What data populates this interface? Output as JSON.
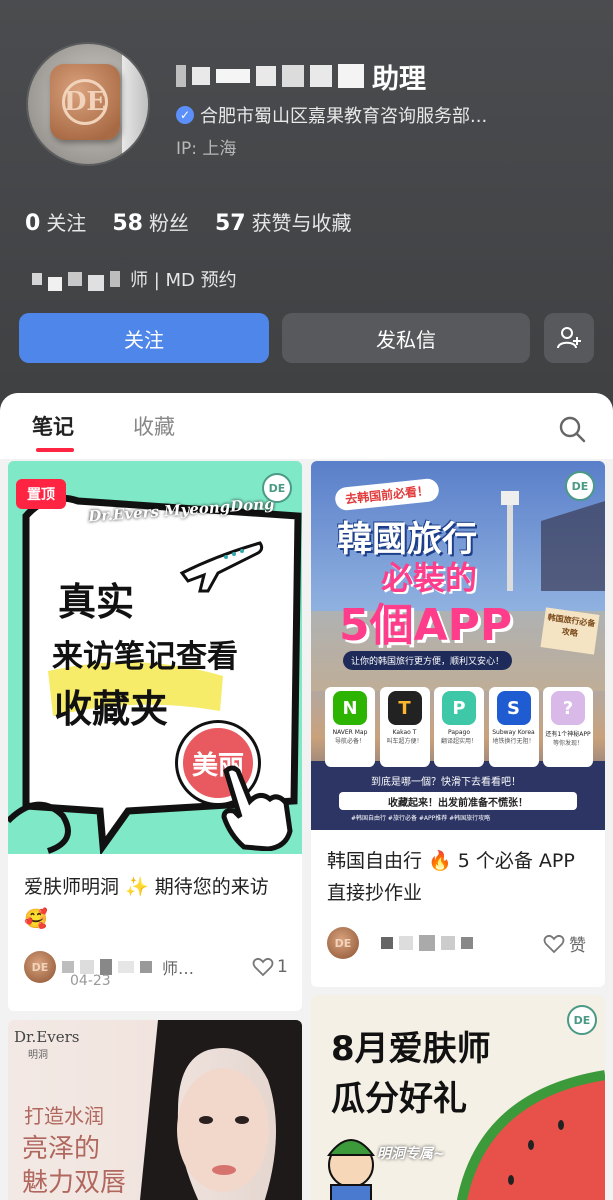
{
  "profile": {
    "name_suffix": "助理",
    "verified_org": "合肥市蜀山区嘉果教育咨询服务部...",
    "ip_label": "IP: 上海",
    "stats": [
      {
        "num": "0",
        "label": "关注"
      },
      {
        "num": "58",
        "label": "粉丝"
      },
      {
        "num": "57",
        "label": "获赞与收藏"
      }
    ],
    "bio_visible": "师 | MD 预约"
  },
  "actions": {
    "follow_label": "关注",
    "message_label": "发私信"
  },
  "tabs": {
    "notes": "笔记",
    "favorites": "收藏"
  },
  "cards": [
    {
      "pin_label": "置顶",
      "cover_brand": "Dr.Evers MyeongDong",
      "cover_lines": [
        "真实",
        "来访笔记查看",
        "收藏夹"
      ],
      "cover_stamp": "美丽",
      "title": "爱肤师明洞 ✨ 期待您的来访🥰",
      "author_visible": "师…",
      "date": "04-23",
      "likes": "1"
    },
    {
      "cover_tag": "去韩国前必看！",
      "cover_title_1": "韓國旅行",
      "cover_title_2": "必裝的",
      "cover_title_3": "5個APP",
      "cover_subtitle": "让你的韩国旅行更方便，顺利又安心！",
      "cover_sticker": "韩国旅行必备攻略",
      "apps": [
        {
          "name": "NAVER Map",
          "desc": "导航必备！",
          "color": "#2db400",
          "glyph": "N"
        },
        {
          "name": "Kakao T",
          "desc": "叫车超方便！",
          "color": "#222222",
          "glyph": "T"
        },
        {
          "name": "Papago",
          "desc": "翻译超实用！",
          "color": "#3fc8a8",
          "glyph": "P"
        },
        {
          "name": "Subway Korea",
          "desc": "地铁换行无阻！",
          "color": "#1f5bd1",
          "glyph": "S"
        },
        {
          "name": "还有1个神秘APP",
          "desc": "等你发现！",
          "color": "#d8b9e8",
          "glyph": "?"
        }
      ],
      "cover_bottom_text": "到底是哪一個？快滑下去看看吧！",
      "cover_banner": "收藏起来！出发前准备不慌张！",
      "cover_hashtags": "#韩国自由行 #旅行必备 #APP推荐 #韩国旅行攻略",
      "title": "韩国自由行 🔥 5 个必备 APP 直接抄作业",
      "like_label": "赞"
    },
    {
      "brand": "Dr.Evers",
      "brand_sub": "明洞",
      "lines": [
        "打造水润",
        "亮泽的",
        "魅力双唇"
      ]
    },
    {
      "headline_1": "8月爱肤师",
      "headline_2": "瓜分好礼",
      "sub": "明洞专属~"
    }
  ],
  "colors": {
    "accent_blue": "#4f86ea",
    "red": "#ff2442"
  }
}
